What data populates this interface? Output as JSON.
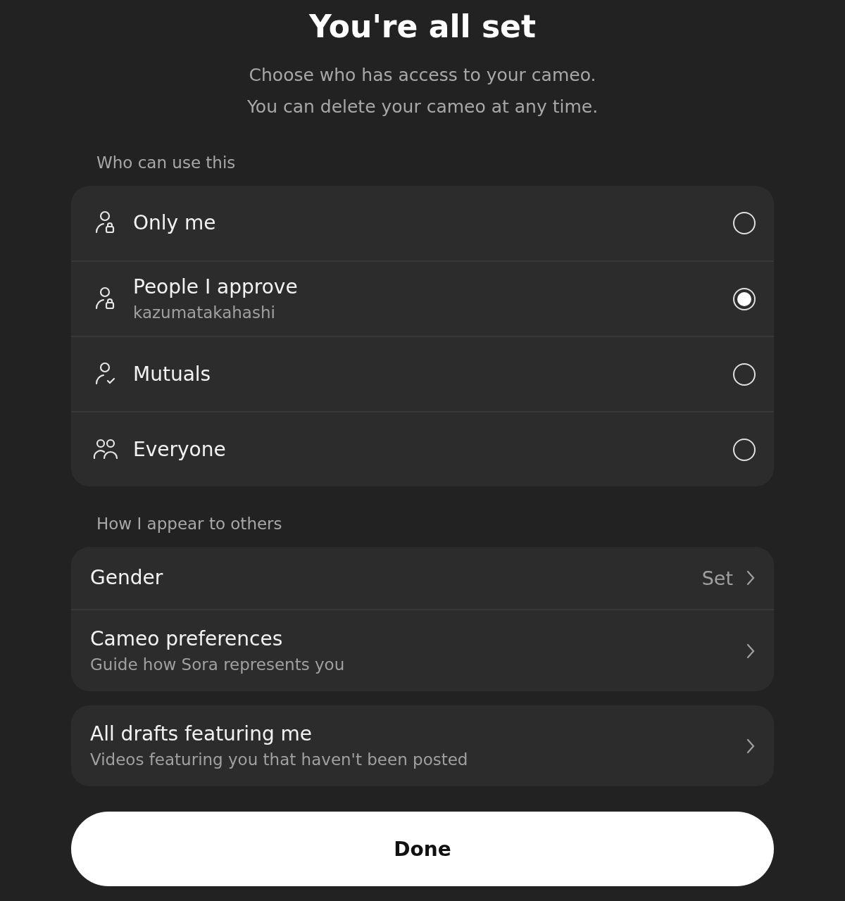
{
  "header": {
    "title": "You're all set",
    "subtitle_lines": [
      "Choose who has access to your cameo.",
      "You can delete your cameo at any time."
    ]
  },
  "access": {
    "label": "Who can use this",
    "options": [
      {
        "kind": "lock",
        "label": "Only me",
        "selected": false
      },
      {
        "kind": "lock",
        "label": "People I approve",
        "detail": "kazumatakahashi",
        "selected": true
      },
      {
        "kind": "check",
        "label": "Mutuals",
        "selected": false
      },
      {
        "kind": "group",
        "label": "Everyone",
        "selected": false
      }
    ]
  },
  "appearance": {
    "label": "How I appear to others",
    "rows": [
      {
        "label": "Gender",
        "value": "Set"
      },
      {
        "label": "Cameo preferences",
        "detail": "Guide how Sora represents you"
      }
    ]
  },
  "drafts": {
    "label": "All drafts featuring me",
    "detail": "Videos featuring you that haven't been posted"
  },
  "done_button": "Done"
}
